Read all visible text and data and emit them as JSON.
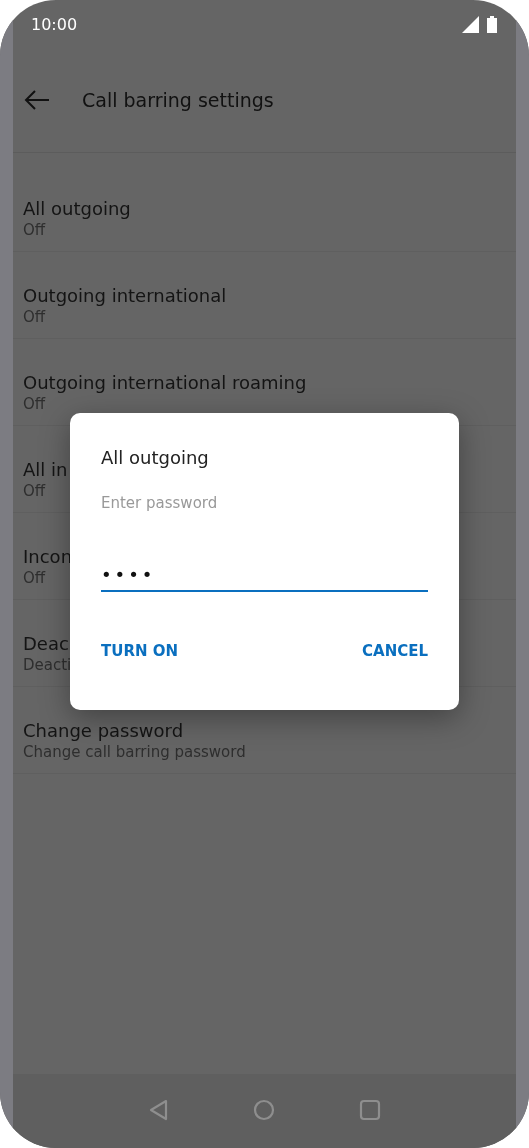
{
  "status_bar": {
    "time": "10:00"
  },
  "toolbar": {
    "title": "Call barring settings"
  },
  "settings": [
    {
      "title": "All outgoing",
      "summary": "Off"
    },
    {
      "title": "Outgoing international",
      "summary": "Off"
    },
    {
      "title": "Outgoing international roaming",
      "summary": "Off"
    },
    {
      "title": "All in",
      "summary": "Off"
    },
    {
      "title": "Incon",
      "summary": "Off"
    },
    {
      "title": "Deac",
      "summary": "Deacti"
    },
    {
      "title": "Change password",
      "summary": "Change call barring password"
    }
  ],
  "dialog": {
    "title": "All outgoing",
    "placeholder": "Enter password",
    "value": "••••",
    "buttons": [
      "TURN ON",
      "CANCEL"
    ]
  }
}
